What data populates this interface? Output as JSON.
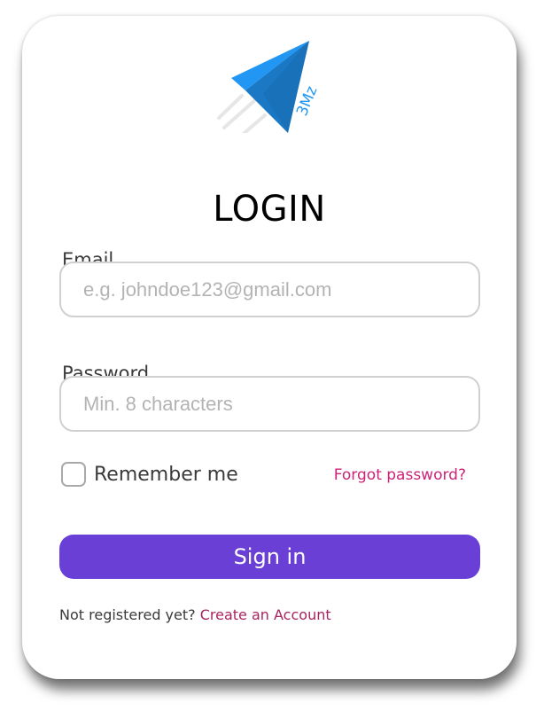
{
  "logo": {
    "icon": "paper-plane-logo-icon",
    "text": "3Mz"
  },
  "title": "LOGIN",
  "email": {
    "label": "Email",
    "placeholder": "e.g. johndoe123@gmail.com",
    "value": ""
  },
  "password": {
    "label": "Password",
    "placeholder": "Min. 8 characters",
    "value": ""
  },
  "remember": {
    "label": "Remember me",
    "checked": false
  },
  "forgot_label": "Forgot password?",
  "signin_label": "Sign in",
  "register": {
    "prompt": "Not registered yet?",
    "link": "Create an Account"
  },
  "colors": {
    "primary": "#6a3fd5",
    "link": "#cc2277",
    "register_link": "#a8235f",
    "logo_blue": "#2196f3",
    "logo_dark_blue": "#1b78c4"
  }
}
